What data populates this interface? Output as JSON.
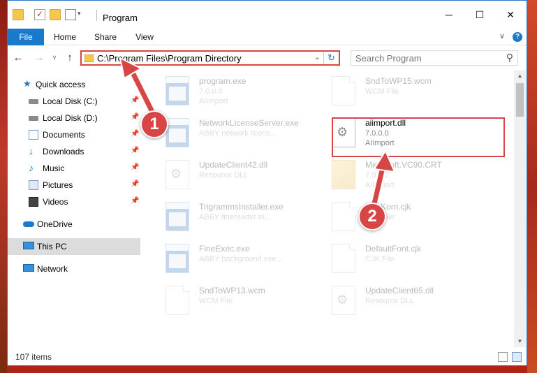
{
  "window": {
    "title": "Program",
    "controls": {
      "minimize": "─",
      "maximize": "☐",
      "close": "✕"
    }
  },
  "ribbon": {
    "tabs": [
      {
        "label": "File",
        "active": true
      },
      {
        "label": "Home"
      },
      {
        "label": "Share"
      },
      {
        "label": "View"
      }
    ],
    "expand_glyph": "∨",
    "help_glyph": "?"
  },
  "address_bar": {
    "path": "C:\\Program Files\\Program Directory",
    "dropdown_glyph": "⌄",
    "refresh_glyph": "↻"
  },
  "search": {
    "placeholder": "Search Program",
    "icon_glyph": "⚲"
  },
  "nav_buttons": {
    "back": "←",
    "forward": "→",
    "recent": "∨",
    "up": "↑"
  },
  "navigation_pane": {
    "items": [
      {
        "label": "Quick access",
        "icon": "star-icon"
      },
      {
        "label": "Local Disk (C:)",
        "icon": "drive-icon",
        "pinned": true
      },
      {
        "label": "Local Disk (D:)",
        "icon": "drive-icon",
        "pinned": true
      },
      {
        "label": "Documents",
        "icon": "documents-icon",
        "pinned": true
      },
      {
        "label": "Downloads",
        "icon": "download-icon",
        "pinned": true
      },
      {
        "label": "Music",
        "icon": "music-icon",
        "pinned": true
      },
      {
        "label": "Pictures",
        "icon": "pictures-icon",
        "pinned": true
      },
      {
        "label": "Videos",
        "icon": "videos-icon",
        "pinned": true
      },
      {
        "label": "OneDrive",
        "icon": "cloud-icon"
      },
      {
        "label": "This PC",
        "icon": "computer-icon",
        "selected": true
      },
      {
        "label": "Network",
        "icon": "network-icon"
      }
    ],
    "pin_glyph": "📌"
  },
  "files": [
    {
      "name": "program.exe",
      "line1": "7.0.0.0",
      "line2": "AIImport",
      "icon": "exe-icon"
    },
    {
      "name": "SndToWP15.wcm",
      "line1": "WCM File",
      "line2": "",
      "icon": "document-icon"
    },
    {
      "name": "NetworkLicenseServer.exe",
      "line1": "ABBY network licens...",
      "line2": "",
      "icon": "exe-icon"
    },
    {
      "name": "aiimport.dll",
      "line1": "7.0.0.0",
      "line2": "AIImport",
      "icon": "gear-document-icon",
      "highlighted": true
    },
    {
      "name": "UpdateClient42.dll",
      "line1": "Resource DLL",
      "line2": "",
      "icon": "gear-document-icon"
    },
    {
      "name": "Microsoft.VC90.CRT",
      "line1": "7.0.0.0",
      "line2": "AIImport",
      "icon": "redist-icon"
    },
    {
      "name": "TrigrammsInstaller.exe",
      "line1": "ABBY finereader tri...",
      "line2": "",
      "icon": "exe-icon"
    },
    {
      "name": "HanKorn.cjk",
      "line1": "CJK File",
      "line2": "",
      "icon": "document-icon"
    },
    {
      "name": "FineExec.exe",
      "line1": "ABBY background exe...",
      "line2": "",
      "icon": "exe-icon"
    },
    {
      "name": "DefaultFont.cjk",
      "line1": "CJK File",
      "line2": "",
      "icon": "document-icon"
    },
    {
      "name": "SndToWP13.wcm",
      "line1": "WCM File",
      "line2": "",
      "icon": "document-icon"
    },
    {
      "name": "UpdateClient65.dll",
      "line1": "Resource DLL",
      "line2": "",
      "icon": "gear-document-icon"
    }
  ],
  "status_bar": {
    "item_count": "107 items"
  },
  "annotations": {
    "step1": "1",
    "step2": "2",
    "color": "#d84545"
  }
}
